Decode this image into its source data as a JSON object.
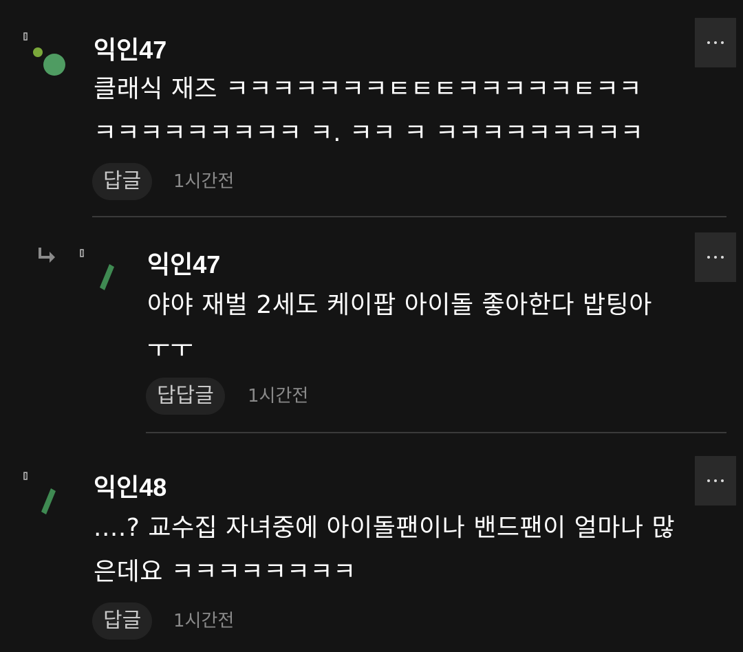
{
  "comments": [
    {
      "nickname": "익인47",
      "lines": [
        "클래식 재즈 ㅋㅋㅋㅋㅋㅋㅋㅌㅌㅌㅋㅋㅋㅋㅋㅌㅋㅋ",
        "ㅋㅋㅋㅋㅋㅋㅋㅋㅋ ㅋ. ㅋㅋ ㅋ ㅋㅋㅋㅋㅋㅋㅋㅋㅋ"
      ],
      "reply_label": "답글",
      "time": "1시간전"
    },
    {
      "nickname": "익인47",
      "lines": [
        "야야 재벌 2세도 케이팝 아이돌 좋아한다 밥팅아",
        "ㅜㅜ"
      ],
      "reply_label": "답답글",
      "time": "1시간전"
    },
    {
      "nickname": "익인48",
      "lines": [
        "....? 교수집 자녀중에 아이돌팬이나 밴드팬이 얼마나 많",
        "은데요 ㅋㅋㅋㅋㅋㅋㅋㅋ"
      ],
      "reply_label": "답글",
      "time": "1시간전"
    }
  ],
  "icons": {
    "more": "more-horizontal-icon",
    "pin": "pin-icon",
    "reply_arrow": "reply-arrow-icon"
  },
  "colors": {
    "background": "#141414",
    "text": "#ffffff",
    "muted": "#8a8a8a",
    "avatar_green": "#3f8a52"
  }
}
